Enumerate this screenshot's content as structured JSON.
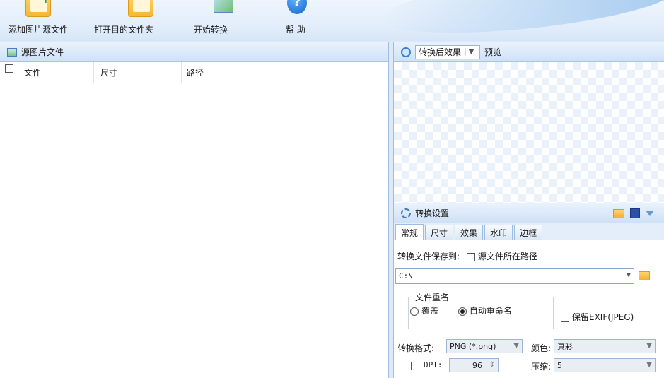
{
  "toolbar": {
    "add_source": "添加图片源文件",
    "open_target": "打开目的文件夹",
    "start_convert": "开始转换",
    "help": "帮 助"
  },
  "left_panel": {
    "title": "源图片文件",
    "columns": [
      "文件",
      "尺寸",
      "路径"
    ]
  },
  "preview": {
    "mode_value": "转换后效果",
    "label": "预览"
  },
  "settings": {
    "title": "转换设置",
    "tabs": [
      "常规",
      "尺寸",
      "效果",
      "水印",
      "边框"
    ],
    "save_to_label": "转换文件保存到:",
    "source_path_option": "源文件所在路径",
    "path_value": "C:\\",
    "rename_group": "文件重名",
    "overwrite": "覆盖",
    "auto_rename": "自动重命名",
    "keep_exif": "保留EXIF(JPEG)",
    "format_label": "转换格式:",
    "format_value": "PNG (*.png)",
    "color_label": "颜色:",
    "color_value": "真彩",
    "dpi_label": "DPI:",
    "dpi_value": "96",
    "compress_label": "压缩:",
    "compress_value": "5"
  }
}
